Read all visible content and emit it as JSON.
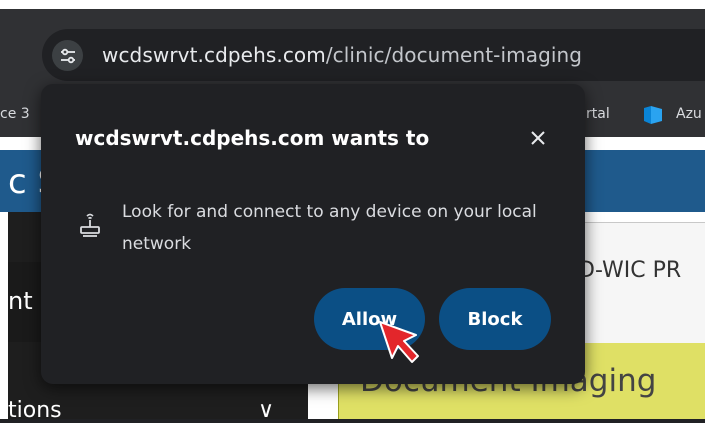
{
  "omnibox": {
    "domain": "wcdswrvt.cdpehs.com",
    "path": "/clinic/document-imaging",
    "site_info_icon": "tune-icon"
  },
  "bookmarks": {
    "left_partial": "ce 3",
    "portal_partial": "rtal",
    "azure_partial": "Azu",
    "azure_icon": "azure-logo-icon"
  },
  "page": {
    "banner_partial": "c S",
    "sidebar_partial": "nt",
    "sidebar_bottom_partial": "tions",
    "sidebar_chevron": "∨",
    "program_partial": "D-WIC PR",
    "document_title": "Document Imaging"
  },
  "popup": {
    "title": "wcdswrvt.cdpehs.com wants to",
    "close_label": "×",
    "permission_text": "Look for and connect to any device on your local network",
    "permission_icon": "local-network-device-icon",
    "allow_label": "Allow",
    "block_label": "Block"
  },
  "colors": {
    "button_bg": "#0b4f85",
    "popup_bg": "#202124",
    "banner_bg": "#1f5a8c",
    "highlight_bg": "#dfe065",
    "cursor_red": "#e3262b"
  }
}
